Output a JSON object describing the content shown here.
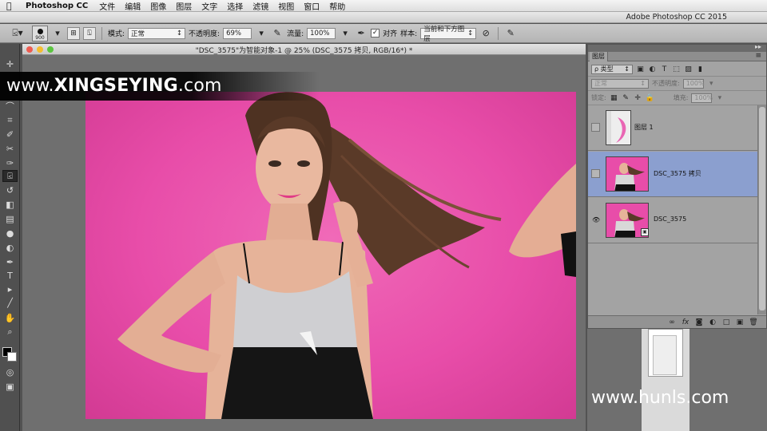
{
  "menubar": {
    "app_name": "Photoshop CC",
    "items": [
      "文件",
      "编辑",
      "图像",
      "图层",
      "文字",
      "选择",
      "滤镜",
      "视图",
      "窗口",
      "帮助"
    ]
  },
  "app_title": "Adobe Photoshop CC 2015",
  "options_bar": {
    "brush_size": "900",
    "mode_label": "模式:",
    "mode_value": "正常",
    "opacity_label": "不透明度:",
    "opacity_value": "69%",
    "flow_label": "流量:",
    "flow_value": "100%",
    "aligned_label": "对齐",
    "aligned_checked": true,
    "sample_label": "样本:",
    "sample_value": "当前和下方图层"
  },
  "document": {
    "title": "\"DSC_3575\"为智能对象-1 @ 25% (DSC_3575 拷贝, RGB/16*) *"
  },
  "watermarks": {
    "top_prefix": "www.",
    "top_brand": "XINGSEYING",
    "top_suffix": ".com",
    "bottom": "www.hunls.com"
  },
  "layers_panel": {
    "tab": "图层",
    "filter_type": "ρ 类型",
    "blend_mode": "正常",
    "opacity_label": "不透明度:",
    "opacity_value": "100%",
    "lock_label": "锁定:",
    "fill_label": "填充:",
    "fill_value": "100%",
    "layers": [
      {
        "name": "图层 1",
        "visible": false,
        "selected": false
      },
      {
        "name": "DSC_3575 拷贝",
        "visible": false,
        "selected": true
      },
      {
        "name": "DSC_3575",
        "visible": true,
        "selected": false
      }
    ]
  },
  "colors": {
    "background_pink": "#e84da9",
    "selected_layer": "#8b9fcf",
    "panel_grey": "#a3a3a3"
  }
}
